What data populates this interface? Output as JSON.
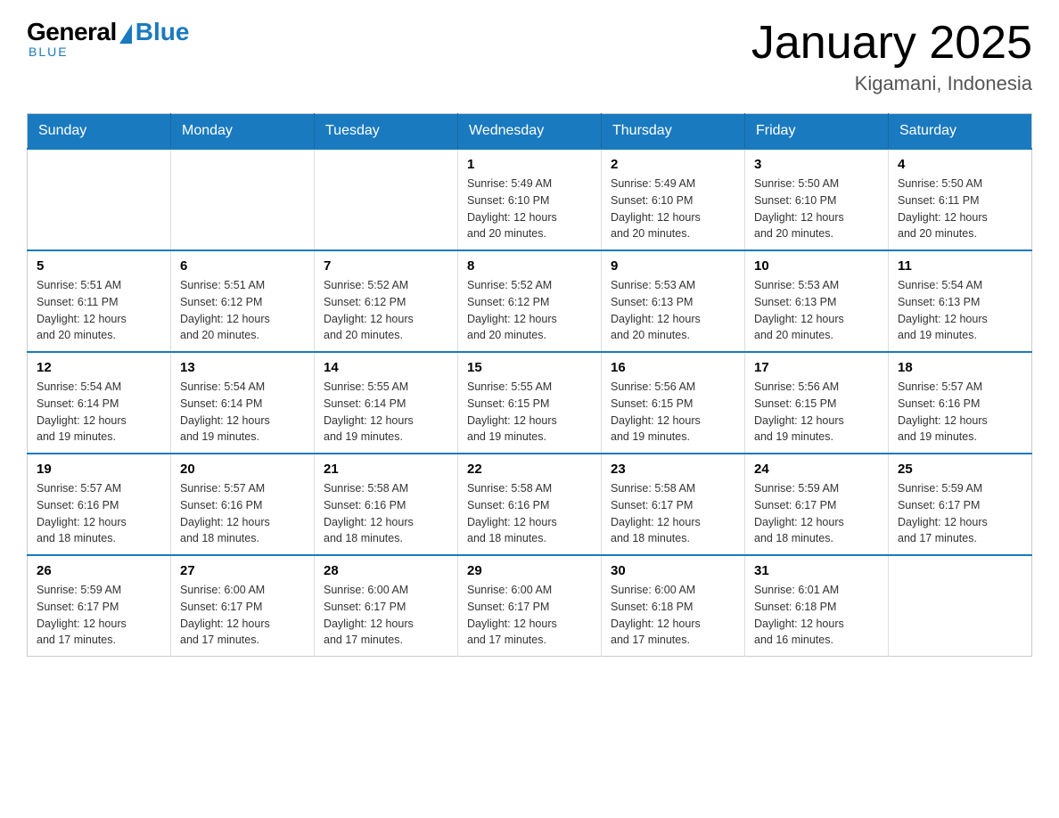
{
  "logo": {
    "general": "General",
    "blue": "Blue",
    "tagline": "Blue"
  },
  "title": "January 2025",
  "subtitle": "Kigamani, Indonesia",
  "weekdays": [
    "Sunday",
    "Monday",
    "Tuesday",
    "Wednesday",
    "Thursday",
    "Friday",
    "Saturday"
  ],
  "weeks": [
    [
      {
        "day": "",
        "info": ""
      },
      {
        "day": "",
        "info": ""
      },
      {
        "day": "",
        "info": ""
      },
      {
        "day": "1",
        "info": "Sunrise: 5:49 AM\nSunset: 6:10 PM\nDaylight: 12 hours\nand 20 minutes."
      },
      {
        "day": "2",
        "info": "Sunrise: 5:49 AM\nSunset: 6:10 PM\nDaylight: 12 hours\nand 20 minutes."
      },
      {
        "day": "3",
        "info": "Sunrise: 5:50 AM\nSunset: 6:10 PM\nDaylight: 12 hours\nand 20 minutes."
      },
      {
        "day": "4",
        "info": "Sunrise: 5:50 AM\nSunset: 6:11 PM\nDaylight: 12 hours\nand 20 minutes."
      }
    ],
    [
      {
        "day": "5",
        "info": "Sunrise: 5:51 AM\nSunset: 6:11 PM\nDaylight: 12 hours\nand 20 minutes."
      },
      {
        "day": "6",
        "info": "Sunrise: 5:51 AM\nSunset: 6:12 PM\nDaylight: 12 hours\nand 20 minutes."
      },
      {
        "day": "7",
        "info": "Sunrise: 5:52 AM\nSunset: 6:12 PM\nDaylight: 12 hours\nand 20 minutes."
      },
      {
        "day": "8",
        "info": "Sunrise: 5:52 AM\nSunset: 6:12 PM\nDaylight: 12 hours\nand 20 minutes."
      },
      {
        "day": "9",
        "info": "Sunrise: 5:53 AM\nSunset: 6:13 PM\nDaylight: 12 hours\nand 20 minutes."
      },
      {
        "day": "10",
        "info": "Sunrise: 5:53 AM\nSunset: 6:13 PM\nDaylight: 12 hours\nand 20 minutes."
      },
      {
        "day": "11",
        "info": "Sunrise: 5:54 AM\nSunset: 6:13 PM\nDaylight: 12 hours\nand 19 minutes."
      }
    ],
    [
      {
        "day": "12",
        "info": "Sunrise: 5:54 AM\nSunset: 6:14 PM\nDaylight: 12 hours\nand 19 minutes."
      },
      {
        "day": "13",
        "info": "Sunrise: 5:54 AM\nSunset: 6:14 PM\nDaylight: 12 hours\nand 19 minutes."
      },
      {
        "day": "14",
        "info": "Sunrise: 5:55 AM\nSunset: 6:14 PM\nDaylight: 12 hours\nand 19 minutes."
      },
      {
        "day": "15",
        "info": "Sunrise: 5:55 AM\nSunset: 6:15 PM\nDaylight: 12 hours\nand 19 minutes."
      },
      {
        "day": "16",
        "info": "Sunrise: 5:56 AM\nSunset: 6:15 PM\nDaylight: 12 hours\nand 19 minutes."
      },
      {
        "day": "17",
        "info": "Sunrise: 5:56 AM\nSunset: 6:15 PM\nDaylight: 12 hours\nand 19 minutes."
      },
      {
        "day": "18",
        "info": "Sunrise: 5:57 AM\nSunset: 6:16 PM\nDaylight: 12 hours\nand 19 minutes."
      }
    ],
    [
      {
        "day": "19",
        "info": "Sunrise: 5:57 AM\nSunset: 6:16 PM\nDaylight: 12 hours\nand 18 minutes."
      },
      {
        "day": "20",
        "info": "Sunrise: 5:57 AM\nSunset: 6:16 PM\nDaylight: 12 hours\nand 18 minutes."
      },
      {
        "day": "21",
        "info": "Sunrise: 5:58 AM\nSunset: 6:16 PM\nDaylight: 12 hours\nand 18 minutes."
      },
      {
        "day": "22",
        "info": "Sunrise: 5:58 AM\nSunset: 6:16 PM\nDaylight: 12 hours\nand 18 minutes."
      },
      {
        "day": "23",
        "info": "Sunrise: 5:58 AM\nSunset: 6:17 PM\nDaylight: 12 hours\nand 18 minutes."
      },
      {
        "day": "24",
        "info": "Sunrise: 5:59 AM\nSunset: 6:17 PM\nDaylight: 12 hours\nand 18 minutes."
      },
      {
        "day": "25",
        "info": "Sunrise: 5:59 AM\nSunset: 6:17 PM\nDaylight: 12 hours\nand 17 minutes."
      }
    ],
    [
      {
        "day": "26",
        "info": "Sunrise: 5:59 AM\nSunset: 6:17 PM\nDaylight: 12 hours\nand 17 minutes."
      },
      {
        "day": "27",
        "info": "Sunrise: 6:00 AM\nSunset: 6:17 PM\nDaylight: 12 hours\nand 17 minutes."
      },
      {
        "day": "28",
        "info": "Sunrise: 6:00 AM\nSunset: 6:17 PM\nDaylight: 12 hours\nand 17 minutes."
      },
      {
        "day": "29",
        "info": "Sunrise: 6:00 AM\nSunset: 6:17 PM\nDaylight: 12 hours\nand 17 minutes."
      },
      {
        "day": "30",
        "info": "Sunrise: 6:00 AM\nSunset: 6:18 PM\nDaylight: 12 hours\nand 17 minutes."
      },
      {
        "day": "31",
        "info": "Sunrise: 6:01 AM\nSunset: 6:18 PM\nDaylight: 12 hours\nand 16 minutes."
      },
      {
        "day": "",
        "info": ""
      }
    ]
  ]
}
